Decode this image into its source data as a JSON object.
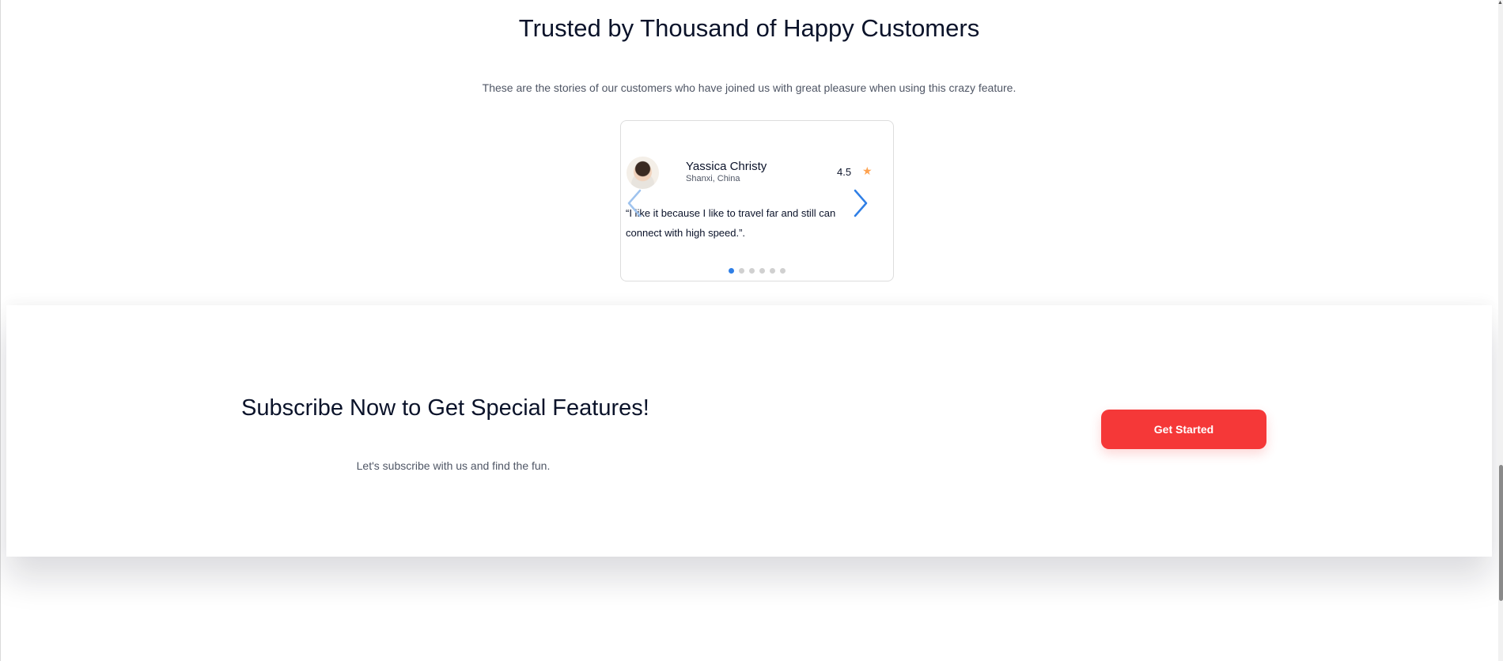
{
  "testimonials": {
    "title": "Trusted by Thousand of Happy Customers",
    "subtitle": "These are the stories of our customers who have joined us with great pleasure when using this crazy feature.",
    "active": {
      "name": "Yassica Christy",
      "location": "Shanxi, China",
      "rating": "4.5",
      "quote": "“I like it because I like to travel far and still can connect with high speed.”."
    },
    "dots": [
      "1",
      "2",
      "3",
      "4",
      "5",
      "6"
    ],
    "active_dot": 0
  },
  "subscribe": {
    "title": "Subscribe Now to Get Special Features!",
    "text": "Let's subscribe with us and find the fun.",
    "button_label": "Get Started"
  },
  "colors": {
    "accent": "#2f7fe6",
    "cta": "#f53838",
    "star": "#fea250",
    "text": "#0b132a",
    "muted": "#4f5665"
  }
}
